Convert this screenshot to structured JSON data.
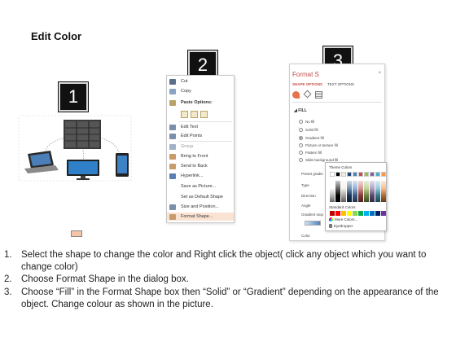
{
  "title": "Edit Color",
  "steps": [
    "1",
    "2",
    "3"
  ],
  "context_menu": {
    "items": [
      {
        "label": "Cut",
        "icon": "scissors-icon",
        "color": "#5a6f8a"
      },
      {
        "label": "Copy",
        "icon": "copy-icon",
        "color": "#8aa3c0"
      },
      {
        "label": "Paste Options:",
        "icon": "clipboard-icon",
        "color": "#b8a46a",
        "bold": true
      },
      {
        "label": "Edit Text",
        "icon": "edit-text-icon",
        "color": "#7a8fa8"
      },
      {
        "label": "Edit Points",
        "icon": "edit-points-icon",
        "color": "#7a8fa8"
      },
      {
        "label": "Group",
        "icon": "group-icon",
        "color": "#9fb2c7"
      },
      {
        "label": "Bring to Front",
        "icon": "bring-front-icon",
        "color": "#c99b6a"
      },
      {
        "label": "Send to Back",
        "icon": "send-back-icon",
        "color": "#c99b6a"
      },
      {
        "label": "Hyperlink...",
        "icon": "hyperlink-icon",
        "color": "#5b7fb5"
      },
      {
        "label": "Save as Picture...",
        "icon": "",
        "color": ""
      },
      {
        "label": "Set as Default Shape",
        "icon": "",
        "color": ""
      },
      {
        "label": "Size and Position...",
        "icon": "size-position-icon",
        "color": "#7a8fa8"
      },
      {
        "label": "Format Shape...",
        "icon": "format-shape-icon",
        "color": "#c99b6a"
      }
    ]
  },
  "format_panel": {
    "title": "Format S",
    "close": "×",
    "tabs": [
      "SHAPE OPTIONS",
      "TEXT OPTIONS"
    ],
    "section": "FILL",
    "fill_options": [
      {
        "label": "No fill",
        "selected": false
      },
      {
        "label": "Solid fill",
        "selected": false
      },
      {
        "label": "Gradient fill",
        "selected": true
      },
      {
        "label": "Picture or texture fill",
        "selected": false
      },
      {
        "label": "Pattern fill",
        "selected": false
      },
      {
        "label": "Slide background fill",
        "selected": false
      }
    ],
    "properties": [
      "Preset gradie",
      "Type",
      "Direction",
      "Angle",
      "Gradient stop",
      "Color"
    ]
  },
  "color_popup": {
    "theme_label": "Theme Colors",
    "standard_label": "Standard Colors",
    "more_colors": "More Colors...",
    "eyedropper": "Eyedropper",
    "theme_colors": [
      "#ffffff",
      "#000000",
      "#eeece1",
      "#1f497d",
      "#4f81bd",
      "#c0504d",
      "#9bbb59",
      "#8064a2",
      "#4bacc6",
      "#f79646"
    ],
    "standard_colors": [
      "#c00000",
      "#ff0000",
      "#ffc000",
      "#ffff00",
      "#92d050",
      "#00b050",
      "#00b0f0",
      "#0070c0",
      "#002060",
      "#7030a0"
    ]
  },
  "instructions": [
    {
      "num": "1.",
      "text": "Select the shape to change the color and Right click the object( click any object which you want to change color)"
    },
    {
      "num": "2.",
      "text": "Choose Format Shape in the dialog box."
    },
    {
      "num": "3.",
      "text": "Choose “Fill” in the Format Shape box then “Solid” or “Gradient” depending on the appearance of the object. Change colour as shown in the picture."
    }
  ]
}
